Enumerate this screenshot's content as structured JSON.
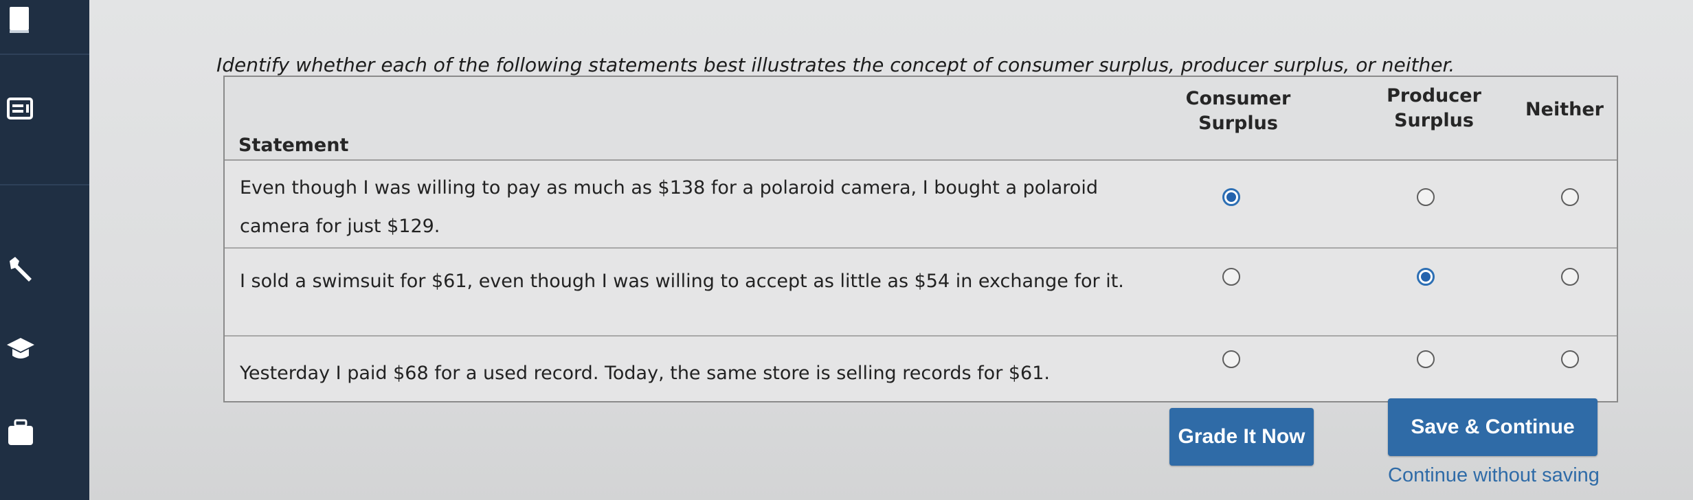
{
  "instructions": "Identify whether each of the following statements best illustrates the concept of consumer surplus, producer surplus, or neither.",
  "table": {
    "headers": {
      "statement": "Statement",
      "consumer": "Consumer\nSurplus",
      "producer": "Producer\nSurplus",
      "neither": "Neither"
    },
    "rows": [
      {
        "statement": "Even though I was willing to pay as much as $138 for a polaroid camera, I bought a polaroid camera for just $129.",
        "selected": "consumer"
      },
      {
        "statement": "I sold a swimsuit for $61, even though I was willing to accept as little as $54 in exchange for it.",
        "selected": "producer"
      },
      {
        "statement": "Yesterday I paid $68 for a used record. Today, the same store is selling records for $61.",
        "selected": null
      }
    ]
  },
  "buttons": {
    "grade": "Grade It Now",
    "save": "Save & Continue",
    "continue_link": "Continue without saving"
  },
  "colors": {
    "sidebar": "#1f2f43",
    "accent": "#2f6ba7",
    "radio_selected": "#2463ad"
  },
  "sidebar_icons": [
    "book-icon",
    "list-icon",
    "wrench-icon",
    "graduation-cap-icon",
    "briefcase-icon"
  ]
}
